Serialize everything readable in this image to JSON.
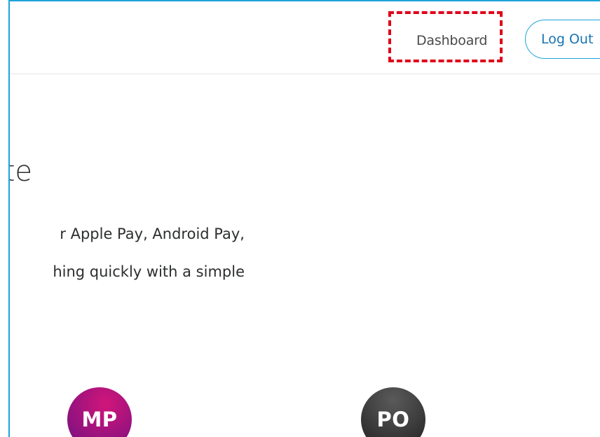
{
  "header": {
    "nav": {
      "dashboard_label": "Dashboard"
    },
    "logout_label": "Log Out",
    "accent_color": "#1ca3d9",
    "highlight_color": "#e0001a"
  },
  "hero": {
    "title_visible": "te",
    "text_line_1": "r Apple Pay, Android Pay,",
    "text_line_2": "hing quickly with a simple"
  },
  "avatars": [
    {
      "initials": "MP",
      "color": "#a4137d"
    },
    {
      "initials": "PO",
      "color": "#3a3a3a"
    }
  ]
}
